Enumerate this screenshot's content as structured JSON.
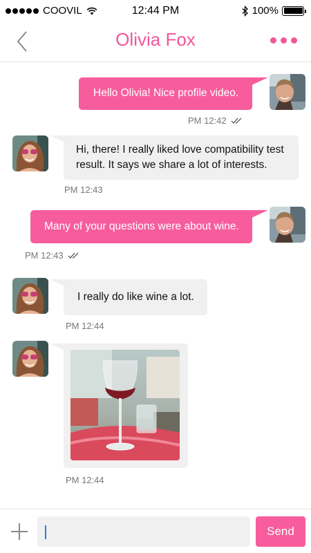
{
  "status_bar": {
    "carrier": "COOVIL",
    "time": "12:44 PM",
    "battery": "100%",
    "icons": [
      "signal-dots-icon",
      "wifi-icon",
      "bluetooth-icon",
      "battery-icon"
    ]
  },
  "header": {
    "title": "Olivia Fox",
    "back_icon": "chevron-left-icon",
    "more_icon": "more-dots-icon",
    "accent_color": "#f1579a"
  },
  "messages": [
    {
      "direction": "outgoing",
      "text": "Hello Olivia! Nice profile video.",
      "time": "PM 12:42",
      "read_receipt": "double-check-icon"
    },
    {
      "direction": "incoming",
      "text": "Hi, there! I really liked love compatibility test result. It says we share a lot of interests.",
      "time": "PM 12:43"
    },
    {
      "direction": "outgoing",
      "text": "Many of your questions were about wine.",
      "time": "PM 12:43",
      "read_receipt": "double-check-icon"
    },
    {
      "direction": "incoming",
      "text": "I really do like wine a lot.",
      "time": "PM 12:44"
    },
    {
      "direction": "incoming",
      "type": "image",
      "image": "wine-glass-photo",
      "time": "PM 12:44"
    }
  ],
  "composer": {
    "input_value": "",
    "placeholder": "",
    "send_label": "Send",
    "add_icon": "plus-icon"
  },
  "colors": {
    "outgoing_bubble": "#f75d9d",
    "incoming_bubble": "#f0f0f0",
    "timestamp": "#777777"
  }
}
